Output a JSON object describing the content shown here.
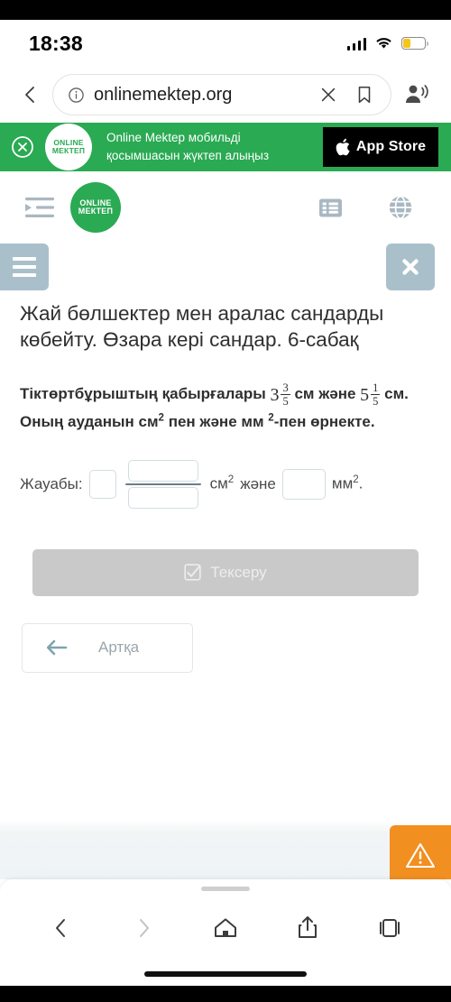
{
  "status_bar": {
    "time": "18:38",
    "signal_icon": "cellular-signal-icon",
    "wifi_icon": "wifi-icon",
    "battery_icon": "battery-icon",
    "battery_level_percent": 36
  },
  "browser": {
    "back_icon": "chevron-left-icon",
    "info_icon": "info-circle-icon",
    "url": "onlinemektep.org",
    "clear_icon": "close-x-icon",
    "bookmark_icon": "bookmark-icon",
    "profile_icon": "person-audio-icon",
    "bottom_nav": {
      "back_icon": "chevron-left-icon",
      "forward_icon": "chevron-right-icon",
      "home_icon": "home-icon",
      "share_icon": "share-upload-icon",
      "tabs_icon": "tabs-icon"
    }
  },
  "app_banner": {
    "close_icon": "close-circle-icon",
    "logo_line1": "ONLINE",
    "logo_line2": "МЕКТЕП",
    "text_line1": "Online Mektep мобильді",
    "text_line2": "қосымшасын жүктеп алыңыз",
    "store_button_label": "App Store",
    "store_icon": "apple-icon",
    "background_color": "#2aaa53"
  },
  "site_header": {
    "menu_icon": "indent-list-icon",
    "logo_line1": "ONLINE",
    "logo_line2": "МЕКТЕП",
    "list_icon": "list-view-icon",
    "globe_icon": "globe-language-icon",
    "logo_color": "#2aaa53"
  },
  "lesson": {
    "menu_icon": "hamburger-menu-icon",
    "close_icon": "close-x-icon",
    "title": "Жай бөлшектер мен аралас сандарды көбейту. Өзара кері сандар. 6-сабақ",
    "problem": {
      "part1": "Тіктөртбұрыштың қабырғалары",
      "value1_whole": "3",
      "value1_num": "3",
      "value1_den": "5",
      "part2": "см және",
      "value2_whole": "5",
      "value2_num": "1",
      "value2_den": "5",
      "part3": "см. Оның ауданын см",
      "sup1": "2",
      "part4": "пен және мм",
      "sup2": "2",
      "part5": "-пен",
      "part6": "өрнекте."
    },
    "answer": {
      "label": "Жауабы:",
      "whole_value": "",
      "numerator_value": "",
      "denominator_value": "",
      "unit1": "см",
      "unit1_sup": "2",
      "conjunction": "және",
      "mm_value": "",
      "unit2": "мм",
      "unit2_sup": "2",
      "period": "."
    },
    "check_button": {
      "label": "Тексеру",
      "icon": "checkbox-checked-icon",
      "disabled": true,
      "background_color": "#c9c9c9"
    },
    "back_button": {
      "label": "Артқа",
      "icon": "arrow-left-icon"
    },
    "warning_button": {
      "icon": "warning-triangle-icon",
      "background_color": "#f18f21"
    }
  }
}
